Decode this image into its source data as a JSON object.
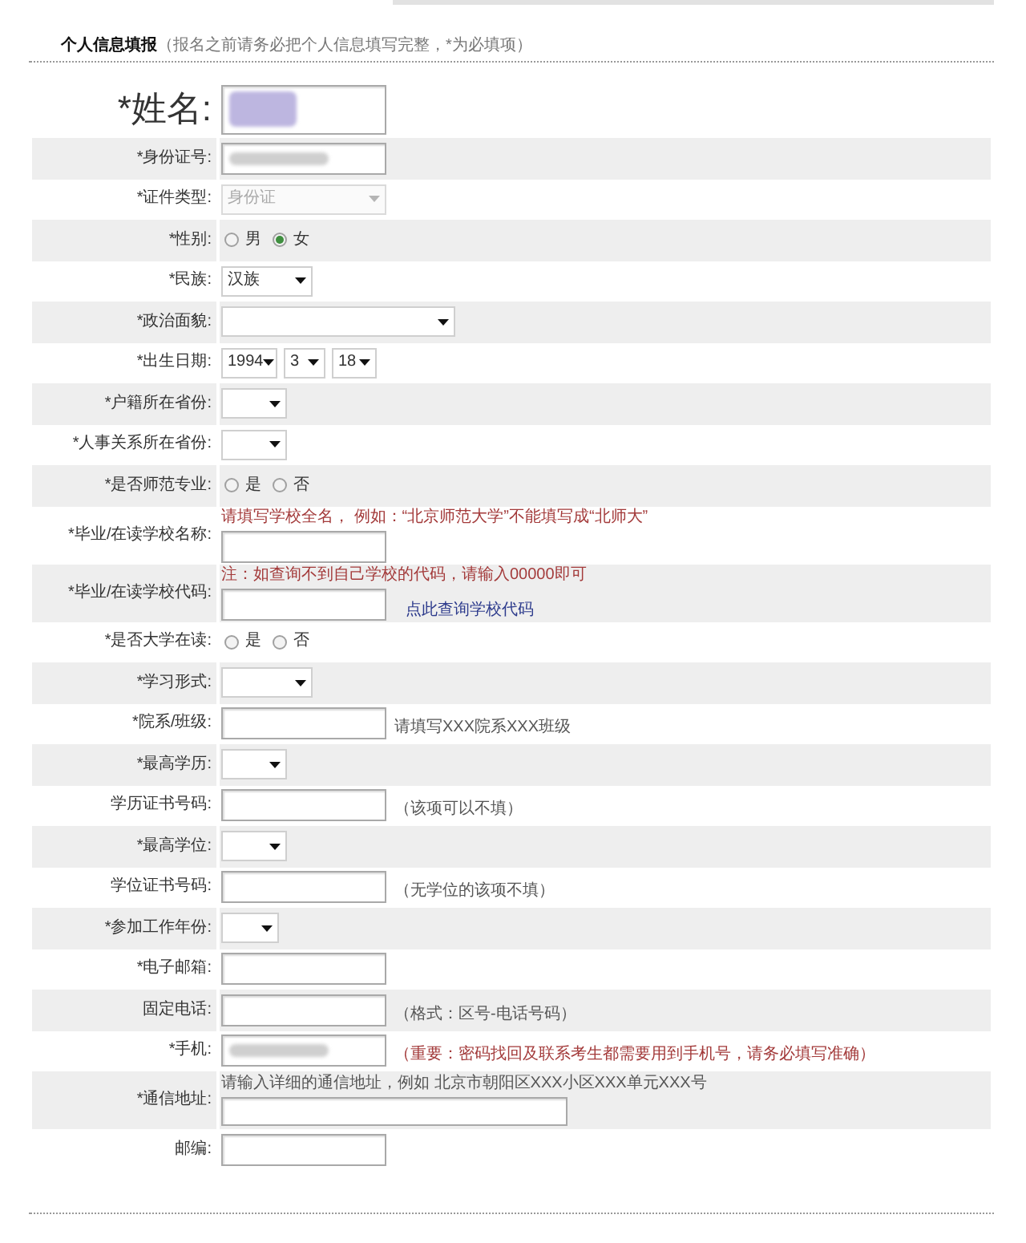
{
  "header": {
    "title": "个人信息填报",
    "note": "（报名之前请务必把个人信息填写完整，*为必填项）"
  },
  "fields": [
    {
      "kind": "name",
      "label": "*姓名:",
      "redacted": true
    },
    {
      "kind": "text",
      "label": "*身份证号:",
      "redacted": true
    },
    {
      "kind": "select",
      "label": "*证件类型:",
      "value": "身份证",
      "disabled": true
    },
    {
      "kind": "radio",
      "label": "*性别:",
      "options": [
        {
          "label": "男",
          "selected": false
        },
        {
          "label": "女",
          "selected": true
        }
      ]
    },
    {
      "kind": "select",
      "label": "*民族:",
      "value": "汉族",
      "disabled": false
    },
    {
      "kind": "select",
      "label": "*政治面貌:",
      "disabled": false
    },
    {
      "kind": "date",
      "label": "*出生日期:",
      "selects": [
        "1994",
        "3",
        "18"
      ]
    },
    {
      "kind": "select",
      "label": "*户籍所在省份:",
      "disabled": false
    },
    {
      "kind": "select",
      "label": "*人事关系所在省份:",
      "disabled": false
    },
    {
      "kind": "radio",
      "label": "*是否师范专业:",
      "options": [
        {
          "label": "是",
          "selected": false
        },
        {
          "label": "否",
          "selected": false
        }
      ]
    },
    {
      "kind": "text",
      "label": "*毕业/在读学校名称:",
      "redacted": false,
      "hint_above": {
        "text": "请填写学校全名， 例如：“北京师范大学”不能填写成“北师大”",
        "warning": true
      }
    },
    {
      "kind": "text",
      "label": "*毕业/在读学校代码:",
      "redacted": false,
      "hint_above": {
        "text": "注：如查询不到自己学校的代码，请输入00000即可",
        "warning": true
      },
      "link": "点此查询学校代码"
    },
    {
      "kind": "radio",
      "label": "*是否大学在读:",
      "options": [
        {
          "label": "是",
          "selected": false
        },
        {
          "label": "否",
          "selected": false
        }
      ]
    },
    {
      "kind": "select",
      "label": "*学习形式:",
      "disabled": false
    },
    {
      "kind": "text",
      "label": "*院系/班级:",
      "redacted": false,
      "hint_after": {
        "text": "请填写XXX院系XXX班级",
        "warning": false
      }
    },
    {
      "kind": "select",
      "label": "*最高学历:",
      "disabled": false
    },
    {
      "kind": "text",
      "label": "学历证书号码:",
      "redacted": false,
      "hint_after": {
        "text": "（该项可以不填）",
        "warning": false
      }
    },
    {
      "kind": "select",
      "label": "*最高学位:",
      "disabled": false
    },
    {
      "kind": "text",
      "label": "学位证书号码:",
      "redacted": false,
      "hint_after": {
        "text": "（无学位的该项不填）",
        "warning": false
      }
    },
    {
      "kind": "select",
      "label": "*参加工作年份:",
      "disabled": false
    },
    {
      "kind": "text",
      "label": "*电子邮箱:",
      "redacted": false
    },
    {
      "kind": "text",
      "label": "固定电话:",
      "redacted": false,
      "hint_after": {
        "text": "（格式：区号-电话号码）",
        "warning": false
      }
    },
    {
      "kind": "text",
      "label": "*手机:",
      "redacted": true,
      "hint_after": {
        "text": "（重要：密码找回及联系考生都需要用到手机号，请务必填写准确）",
        "warning": true
      }
    },
    {
      "kind": "text",
      "label": "*通信地址:",
      "redacted": false,
      "hint_above": {
        "text": "请输入详细的通信地址，例如 北京市朝阳区XXX小区XXX单元XXX号",
        "warning": false
      }
    },
    {
      "kind": "text",
      "label": "邮编:",
      "redacted": false
    }
  ]
}
